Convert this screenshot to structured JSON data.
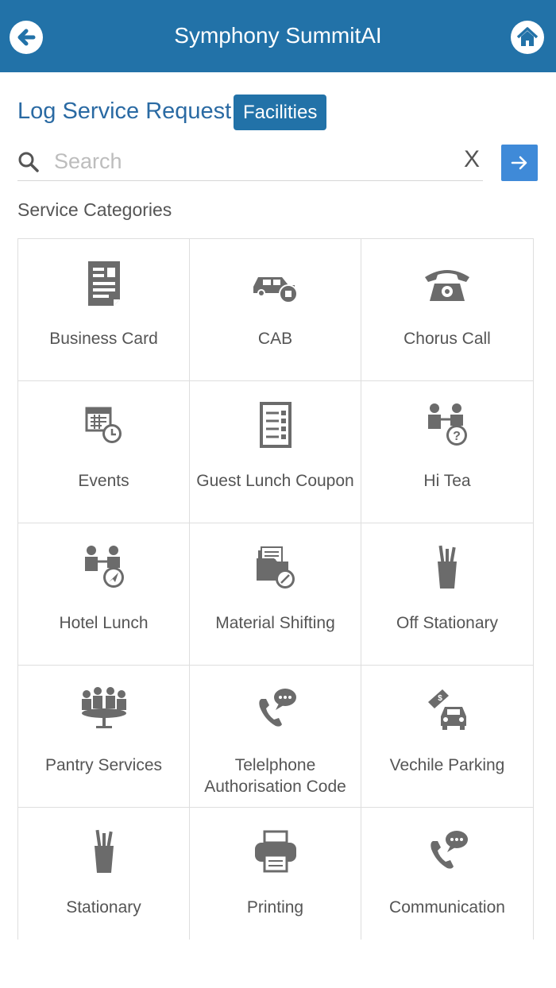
{
  "header": {
    "title": "Symphony SummitAI",
    "back_icon": "back-arrow-icon",
    "home_icon": "home-icon"
  },
  "page": {
    "title": "Log Service Request",
    "chip": "Facilities"
  },
  "search": {
    "placeholder": "Search",
    "value": "",
    "clear_label": "X",
    "go_icon": "arrow-right-icon"
  },
  "section_label": "Service Categories",
  "colors": {
    "brand": "#2272a8",
    "accent": "#3f8ad8",
    "icon": "#6b6b6b"
  },
  "categories": [
    {
      "label": "Business Card",
      "icon": "business-card-icon"
    },
    {
      "label": "CAB",
      "icon": "cab-icon"
    },
    {
      "label": "Chorus Call",
      "icon": "telephone-icon"
    },
    {
      "label": "Events",
      "icon": "calendar-clock-icon"
    },
    {
      "label": "Guest Lunch Coupon",
      "icon": "checklist-icon"
    },
    {
      "label": "Hi Tea",
      "icon": "meeting-help-icon"
    },
    {
      "label": "Hotel Lunch",
      "icon": "meeting-navigation-icon"
    },
    {
      "label": "Material Shifting",
      "icon": "folder-compass-icon"
    },
    {
      "label": "Off Stationary",
      "icon": "pen-cup-icon"
    },
    {
      "label": "Pantry Services",
      "icon": "round-table-icon"
    },
    {
      "label": "Telelphone Authorisation Code",
      "icon": "phone-chat-icon"
    },
    {
      "label": "Vechile Parking",
      "icon": "car-parking-icon"
    },
    {
      "label": "Stationary",
      "icon": "pen-cup-icon"
    },
    {
      "label": "Printing",
      "icon": "printer-icon"
    },
    {
      "label": "Communication",
      "icon": "phone-chat-icon"
    }
  ]
}
